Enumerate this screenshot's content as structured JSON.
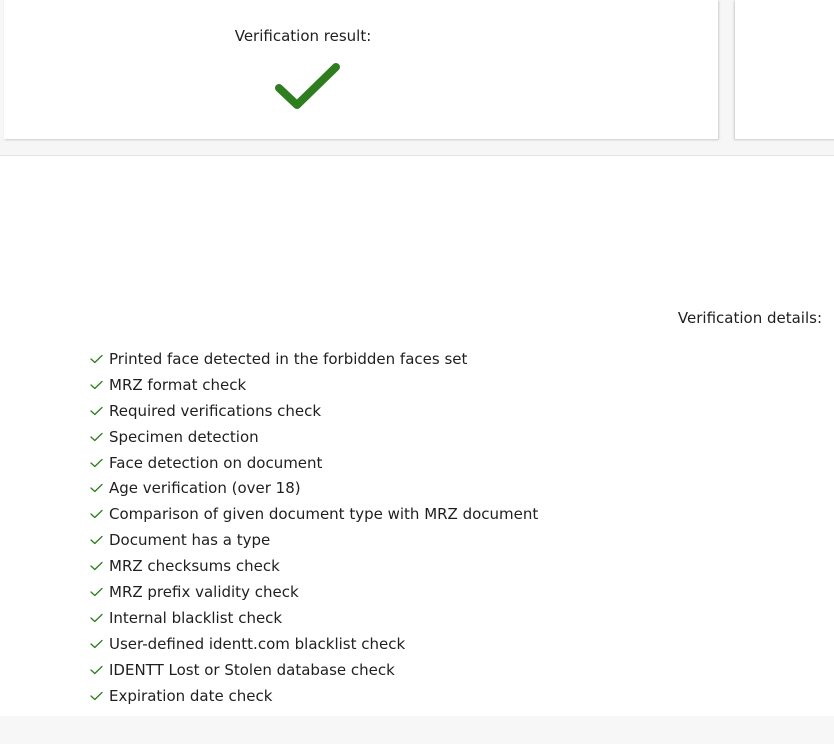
{
  "result_card": {
    "title": "Verification result:",
    "status_icon": "checkmark-icon",
    "status_color": "#2e7d1f"
  },
  "details": {
    "title": "Verification details:",
    "tick_color": "#2e7d1f",
    "checks": [
      {
        "label": "Printed face detected in the forbidden faces set"
      },
      {
        "label": "MRZ format check"
      },
      {
        "label": "Required verifications check"
      },
      {
        "label": "Specimen detection"
      },
      {
        "label": "Face detection on document"
      },
      {
        "label": "Age verification (over 18)"
      },
      {
        "label": "Comparison of given document type with MRZ document"
      },
      {
        "label": "Document has a type"
      },
      {
        "label": "MRZ checksums check"
      },
      {
        "label": "MRZ prefix validity check"
      },
      {
        "label": "Internal blacklist check"
      },
      {
        "label": "User-defined identt.com blacklist check"
      },
      {
        "label": "IDENTT Lost or Stolen database check"
      },
      {
        "label": "Expiration date check"
      }
    ]
  }
}
